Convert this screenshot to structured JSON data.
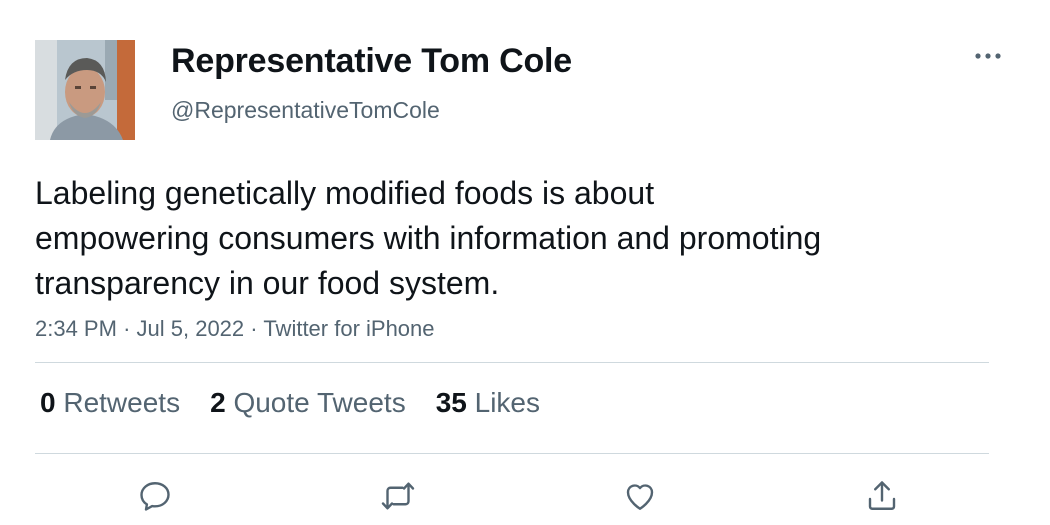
{
  "tweet": {
    "author": {
      "display_name": "Representative Tom Cole",
      "handle": "@RepresentativeTomCole"
    },
    "text": "Labeling genetically modified foods is about\nempowering consumers with information and promoting\ntransparency in our food system.",
    "time": "2:34 PM",
    "separator": "·",
    "date": "Jul 5, 2022",
    "source": "Twitter for iPhone",
    "stats": {
      "retweets_count": "0",
      "retweets_label": "Retweets",
      "quote_count": "2",
      "quote_label": "Quote Tweets",
      "likes_count": "35",
      "likes_label": "Likes"
    },
    "actions": [
      "reply-icon",
      "retweet-icon",
      "like-icon",
      "share-icon"
    ],
    "more_icon": "more-icon"
  },
  "colors": {
    "primary_text": "#0f1419",
    "secondary_text": "#536471",
    "divider": "#cfd9de",
    "background": "#ffffff"
  }
}
